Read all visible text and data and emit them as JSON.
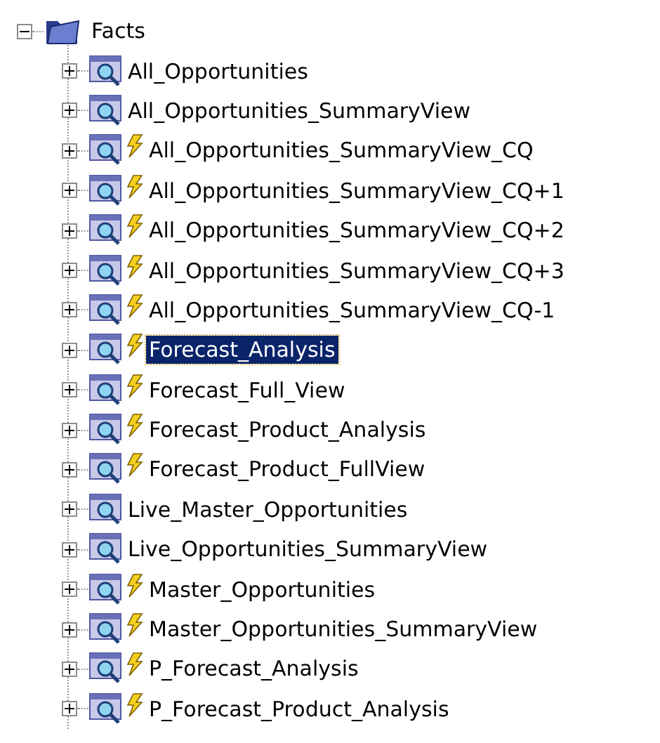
{
  "tree": {
    "label": "Facts",
    "expanded": true,
    "children": [
      {
        "label": "All_Opportunities",
        "expanded": false,
        "bolt": false,
        "selected": false
      },
      {
        "label": "All_Opportunities_SummaryView",
        "expanded": false,
        "bolt": false,
        "selected": false
      },
      {
        "label": "All_Opportunities_SummaryView_CQ",
        "expanded": false,
        "bolt": true,
        "selected": false
      },
      {
        "label": "All_Opportunities_SummaryView_CQ+1",
        "expanded": false,
        "bolt": true,
        "selected": false
      },
      {
        "label": "All_Opportunities_SummaryView_CQ+2",
        "expanded": false,
        "bolt": true,
        "selected": false
      },
      {
        "label": "All_Opportunities_SummaryView_CQ+3",
        "expanded": false,
        "bolt": true,
        "selected": false
      },
      {
        "label": "All_Opportunities_SummaryView_CQ-1",
        "expanded": false,
        "bolt": true,
        "selected": false
      },
      {
        "label": "Forecast_Analysis",
        "expanded": false,
        "bolt": true,
        "selected": true
      },
      {
        "label": "Forecast_Full_View",
        "expanded": false,
        "bolt": true,
        "selected": false
      },
      {
        "label": "Forecast_Product_Analysis",
        "expanded": false,
        "bolt": true,
        "selected": false
      },
      {
        "label": "Forecast_Product_FullView",
        "expanded": false,
        "bolt": true,
        "selected": false
      },
      {
        "label": "Live_Master_Opportunities",
        "expanded": false,
        "bolt": false,
        "selected": false
      },
      {
        "label": "Live_Opportunities_SummaryView",
        "expanded": false,
        "bolt": false,
        "selected": false
      },
      {
        "label": "Master_Opportunities",
        "expanded": false,
        "bolt": true,
        "selected": false
      },
      {
        "label": "Master_Opportunities_SummaryView",
        "expanded": false,
        "bolt": true,
        "selected": false
      },
      {
        "label": "P_Forecast_Analysis",
        "expanded": false,
        "bolt": true,
        "selected": false
      },
      {
        "label": "P_Forecast_Product_Analysis",
        "expanded": false,
        "bolt": true,
        "selected": false
      }
    ]
  }
}
